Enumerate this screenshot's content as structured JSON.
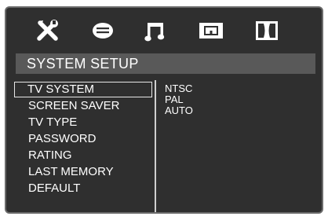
{
  "tabs": [
    {
      "icon": "tools-icon",
      "name": "system-setup"
    },
    {
      "icon": "speech-bubble-icon",
      "name": "language"
    },
    {
      "icon": "music-note-icon",
      "name": "audio"
    },
    {
      "icon": "video-icon",
      "name": "video"
    },
    {
      "icon": "dolby-icon",
      "name": "speaker"
    }
  ],
  "title": "SYSTEM SETUP",
  "menu": {
    "items": [
      "TV SYSTEM",
      "SCREEN SAVER",
      "TV TYPE",
      "PASSWORD",
      "RATING",
      "LAST MEMORY",
      "DEFAULT"
    ],
    "selected": "TV SYSTEM"
  },
  "options": {
    "items": [
      "NTSC",
      "PAL",
      "AUTO"
    ]
  },
  "colors": {
    "background": "#2f2f2f",
    "title_bar": "#595959",
    "text": "#ffffff",
    "frame": "#6b6b6b"
  }
}
